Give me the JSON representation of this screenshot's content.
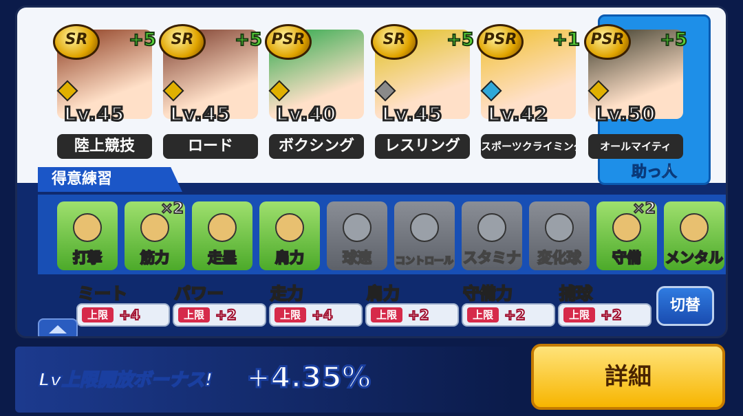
{
  "cards": [
    {
      "rank": "SR",
      "plus": "+5",
      "level": "Lv.45",
      "name": "陸上競技",
      "color": "#8b3a1e",
      "diamond": "#e0b000"
    },
    {
      "rank": "SR",
      "plus": "+5",
      "level": "Lv.45",
      "name": "ロード",
      "color": "#7a3a2a",
      "diamond": "#e0b000"
    },
    {
      "rank": "PSR",
      "plus": "",
      "level": "Lv.40",
      "name": "ボクシング",
      "color": "#2aa84a",
      "diamond": "#e0b000"
    },
    {
      "rank": "SR",
      "plus": "+5",
      "level": "Lv.45",
      "name": "レスリング",
      "color": "#e0c020",
      "diamond": "#8a8a8a"
    },
    {
      "rank": "PSR",
      "plus": "+1",
      "level": "Lv.42",
      "name": "スポーツクライミング",
      "color": "#f0c030",
      "diamond": "#30a8d8"
    },
    {
      "rank": "PSR",
      "plus": "+5",
      "level": "Lv.50",
      "name": "オールマイティ",
      "color": "#3a3a2a",
      "diamond": "#e0b000"
    }
  ],
  "helper_label": "助っ人",
  "practice_title": "得意練習",
  "practices": [
    {
      "label": "打撃",
      "active": true,
      "mult": ""
    },
    {
      "label": "筋力",
      "active": true,
      "mult": "×2"
    },
    {
      "label": "走塁",
      "active": true,
      "mult": ""
    },
    {
      "label": "肩力",
      "active": true,
      "mult": ""
    },
    {
      "label": "球速",
      "active": false,
      "mult": ""
    },
    {
      "label": "コントロール",
      "active": false,
      "mult": ""
    },
    {
      "label": "スタミナ",
      "active": false,
      "mult": ""
    },
    {
      "label": "変化球",
      "active": false,
      "mult": ""
    },
    {
      "label": "守備",
      "active": true,
      "mult": "×2"
    },
    {
      "label": "メンタル",
      "active": true,
      "mult": ""
    }
  ],
  "stats": [
    {
      "name": "ミート",
      "cap": "上限",
      "value": "+4"
    },
    {
      "name": "パワー",
      "cap": "上限",
      "value": "+2"
    },
    {
      "name": "走力",
      "cap": "上限",
      "value": "+4"
    },
    {
      "name": "肩力",
      "cap": "上限",
      "value": "+2"
    },
    {
      "name": "守備力",
      "cap": "上限",
      "value": "+2"
    },
    {
      "name": "捕球",
      "cap": "上限",
      "value": "+2"
    }
  ],
  "switch_label": "切替",
  "bonus_label": "Lv上限開放ボーナス!",
  "bonus_value": "+4.35%",
  "detail_label": "詳細"
}
